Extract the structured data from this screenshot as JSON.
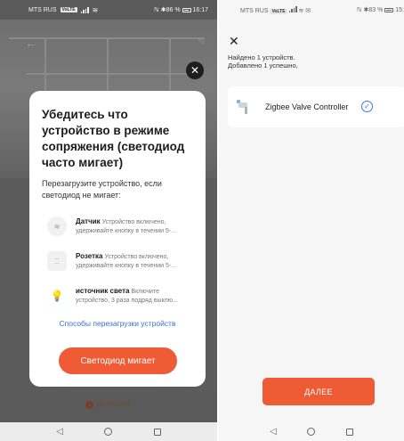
{
  "left_screen": {
    "status": {
      "carrier": "MTS RUS",
      "network_badge": "VoLTE",
      "battery_text": "✱86 %",
      "time": "16:17"
    },
    "modal": {
      "title": "Убедитесь что устройство в режиме сопряжения (светодиод часто мигает)",
      "subtitle": "Перезагрузите устройство, если светодиод не мигает:",
      "items": [
        {
          "icon": "sensor-icon",
          "name": "Датчик",
          "desc": "Устройство включено, удерживайте кнопку в течении 5-..."
        },
        {
          "icon": "socket-icon",
          "name": "Розетка",
          "desc": "Устройство включено, удерживайте кнопку в течении 5-..."
        },
        {
          "icon": "bulb-icon",
          "name": "источник света",
          "desc": "Включите устройство, 3 раза подряд выклю..."
        }
      ],
      "reset_link": "Способы перезагрузки устройств",
      "confirm_button": "Светодиод мигает"
    },
    "add_label": "Добавить",
    "colors": {
      "accent": "#ee5b35",
      "link": "#3b6fd4"
    }
  },
  "right_screen": {
    "status": {
      "carrier": "MTS RUS",
      "network_badge": "VoLTE",
      "battery_text": "✱83 %",
      "time": "15:"
    },
    "found_line1": "Найдено 1 устройств.",
    "found_line2": "Добавлено 1 успешно.",
    "device": {
      "name": "Zigbee Valve Controller",
      "status": "added"
    },
    "next_button": "ДАЛЕЕ"
  }
}
